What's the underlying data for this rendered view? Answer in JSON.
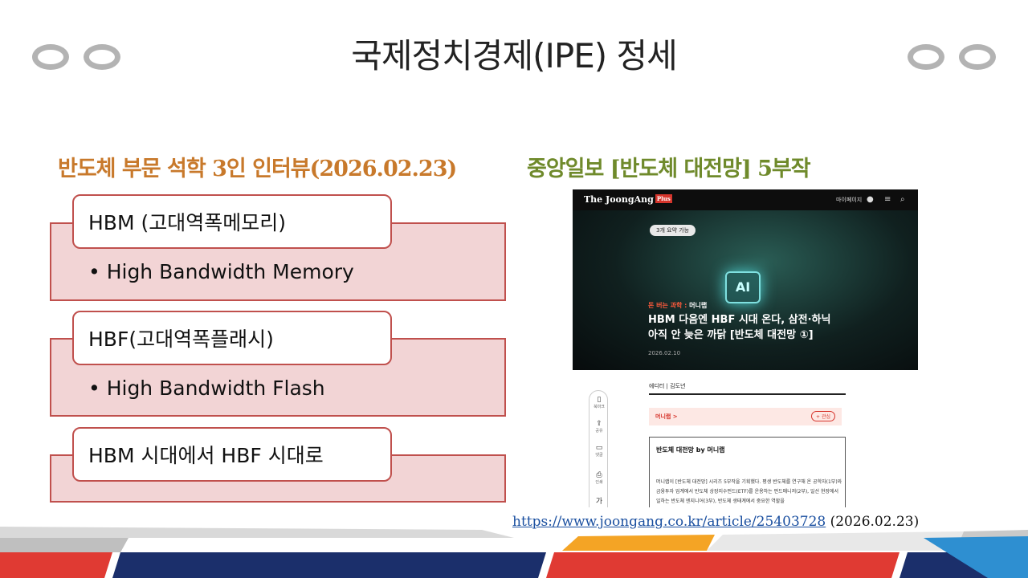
{
  "title": "국제정치경제(IPE) 정세",
  "subtitle_left": "반도체 부문 석학 3인 인터뷰(2026.02.23)",
  "subtitle_right": "중앙일보 [반도체 대전망] 5부작",
  "terms": [
    {
      "term": "HBM (고대역폭메모리)",
      "detail": "• High Bandwidth Memory"
    },
    {
      "term": "HBF(고대역폭플래시)",
      "detail": "• High Bandwidth Flash"
    },
    {
      "term": "HBM 시대에서 HBF 시대로",
      "detail": ""
    }
  ],
  "article": {
    "logo": "The JoongAng",
    "logo_badge": "Plus",
    "mypage": "마이페이지",
    "pill": "3개 요약 가능",
    "chip": "AI",
    "kicker_red": "돈 버는 과학 :",
    "kicker_white": "머니랩",
    "headline": "HBM 다음엔 HBF 시대 온다, 삼전·하닉 아직 안 늦은 까닭 [반도체 대전망 ①]",
    "date": "2026.02.10",
    "byline": "에디터 | 김도년",
    "series": "머니랩 >",
    "follow": "+ 관심",
    "summary_title": "반도체 대전망 by 머니랩",
    "summary_text": "머니랩이 [반도체 대전망] 시리즈 5부작을 기획했다. 평생 반도체를 연구해 온 공학자(1부)와 금융투자 업계에서 반도체 상장지수펀드(ETF)를 운용하는 펀드매니저(2부), 일선 현장에서 일하는 반도체 엔지니어(3부), 반도체 생태계에서 중요한 역할을",
    "side": [
      {
        "icon": "bookmark-icon",
        "glyph": "▯",
        "label": "북마크"
      },
      {
        "icon": "share-icon",
        "glyph": "⇪",
        "label": "공유"
      },
      {
        "icon": "comment-icon",
        "glyph": "▭",
        "label": "댓글"
      },
      {
        "icon": "print-icon",
        "glyph": "⎙",
        "label": "인쇄"
      },
      {
        "icon": "font-icon",
        "glyph": "가",
        "label": ""
      }
    ]
  },
  "source": {
    "url": "https://www.joongang.co.kr/article/25403728",
    "date": "(2026.02.23)"
  },
  "colors": {
    "box_fill": "#f2d4d5",
    "box_border": "#c0504d",
    "subtitle_left": "#c8792b",
    "subtitle_right": "#6f8a2b"
  }
}
